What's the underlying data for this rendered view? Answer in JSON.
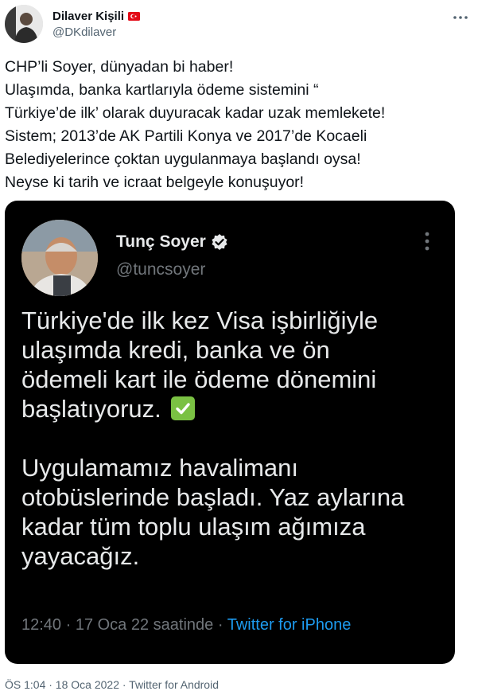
{
  "author": {
    "display_name": "Dilaver Kişili",
    "handle": "@DKdilaver",
    "flag_icon": "turkey-flag-icon"
  },
  "tweet": {
    "text": "CHP’li Soyer, dünyadan bi haber!\nUlaşımda, banka kartlarıyla ödeme sistemini “\nTürkiye’de ilk’ olarak duyuracak kadar uzak memlekete!\nSistem; 2013’de AK Partili Konya ve 2017’de Kocaeli\nBelediyelerince çoktan uygulanmaya başlandı oysa!\nNeyse ki tarih ve icraat belgeyle konuşuyor!",
    "timestamp": "ÖS 1:04 · 18 Oca 2022 · Twitter for Android"
  },
  "embedded_tweet": {
    "display_name": "Tunç Soyer",
    "handle": "@tuncsoyer",
    "text_part1": "Türkiye'de ilk kez Visa işbirliğiyle\nulaşımda kredi, banka ve ön\nödemeli kart ile ödeme dönemini\nbaşlatıyoruz.",
    "text_part2": "\n\nUygulamamız havalimanı\notobüslerinde başladı. Yaz aylarına\nkadar tüm toplu ulaşım ağımıza\nyayacağız.",
    "meta_time": "12:40 · 17 Oca 22 saatinde · ",
    "meta_source": "Twitter for iPhone"
  },
  "colors": {
    "link_blue": "#1d9bf0",
    "embed_bg": "#000000",
    "check_green": "#7ac143"
  }
}
